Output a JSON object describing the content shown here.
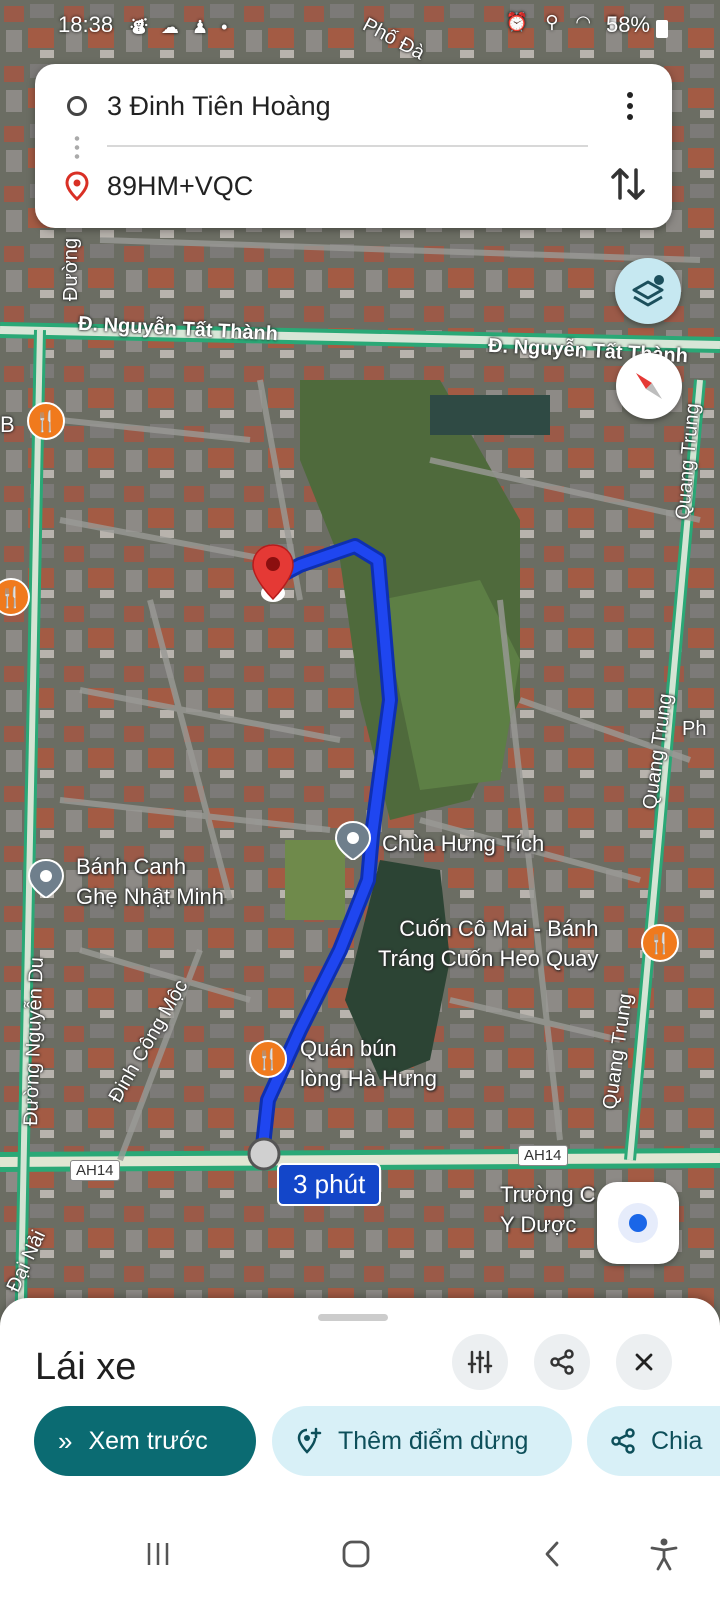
{
  "status_bar": {
    "time": "18:38",
    "battery": "58%"
  },
  "route_card": {
    "origin": "3 Đinh Tiên Hoàng",
    "destination": "89HM+VQC"
  },
  "map": {
    "street_labels": [
      "Phố Đà",
      "Đường",
      "Đ. Nguyễn Tất Thành",
      "Đ. Nguyễn Tất Thành",
      "B",
      "Quang Trung",
      "Quang Trung",
      "Quang Trung",
      "Ph",
      "Đường Nguyễn Du",
      "Đinh Công Mộc",
      "Đại Nải"
    ],
    "places": [
      {
        "name": "Chùa Hưng Tích"
      },
      {
        "name": "Bánh Canh\nGhẹ Nhật Minh"
      },
      {
        "name": "Cuốn Cô Mai - Bánh\nTráng Cuốn Heo Quay"
      },
      {
        "name": "Quán bún\nlòng Hà Hưng"
      },
      {
        "name": "Trường C     ởng\nY Dược      họ"
      }
    ],
    "route_shields": [
      "AH14",
      "AH14"
    ],
    "travel_time": "3 phút",
    "route_color": "#1f46f0"
  },
  "sheet": {
    "title": "Lái xe",
    "chips": {
      "preview": "Xem trước",
      "add_stop": "Thêm điểm dừng",
      "share": "Chia"
    }
  },
  "colors": {
    "accent": "#0b6b72",
    "chip_secondary": "#d8f0f7",
    "pin_red": "#e53935",
    "food_orange": "#f07a1d"
  }
}
